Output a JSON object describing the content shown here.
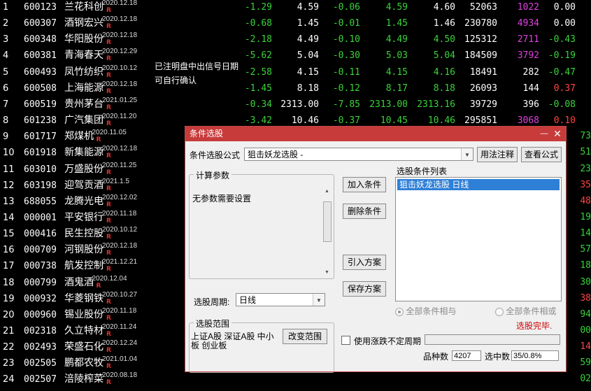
{
  "rows": [
    {
      "idx": "1",
      "code": "600123",
      "name": "兰花科创",
      "date": "2020.12.18",
      "flag": "R",
      "chg": "-1.29",
      "price": "4.59",
      "d": "-0.06",
      "buy": "4.59",
      "sell": "4.60",
      "vol": "52063",
      "cur": "1022",
      "cur_color": "magenta",
      "pct": "0.00",
      "pct_color": "white",
      "sell_color": "white"
    },
    {
      "idx": "2",
      "code": "600307",
      "name": "酒钢宏兴",
      "date": "2020.12.18",
      "flag": "R",
      "chg": "-0.68",
      "price": "1.45",
      "d": "-0.01",
      "buy": "1.45",
      "sell": "1.46",
      "vol": "230780",
      "cur": "4934",
      "cur_color": "magenta",
      "pct": "0.00",
      "pct_color": "white",
      "sell_color": "white"
    },
    {
      "idx": "3",
      "code": "600348",
      "name": "华阳股份",
      "date": "2020.12.18",
      "flag": "R",
      "chg": "-2.18",
      "price": "4.49",
      "d": "-0.10",
      "buy": "4.49",
      "sell": "4.50",
      "vol": "125312",
      "cur": "2711",
      "cur_color": "magenta",
      "pct": "-0.43",
      "pct_color": "green",
      "sell_color": "green"
    },
    {
      "idx": "4",
      "code": "600381",
      "name": "青海春天",
      "date": "2020.12.29",
      "flag": "R",
      "chg": "-5.62",
      "price": "5.04",
      "d": "-0.30",
      "buy": "5.03",
      "sell": "5.04",
      "vol": "184509",
      "cur": "3792",
      "cur_color": "magenta",
      "pct": "-0.19",
      "pct_color": "green",
      "sell_color": "green"
    },
    {
      "idx": "5",
      "code": "600493",
      "name": "凤竹纺织",
      "date": "2020.10.12",
      "flag": "R",
      "chg": "-2.58",
      "price": "4.15",
      "d": "-0.11",
      "buy": "4.15",
      "sell": "4.16",
      "vol": "18491",
      "cur": "282",
      "cur_color": "white",
      "pct": "-0.47",
      "pct_color": "green",
      "sell_color": "green"
    },
    {
      "idx": "6",
      "code": "600508",
      "name": "上海能源",
      "date": "2020.12.18",
      "flag": "R",
      "chg": "-1.45",
      "price": "8.18",
      "d": "-0.12",
      "buy": "8.17",
      "sell": "8.18",
      "vol": "26093",
      "cur": "144",
      "cur_color": "white",
      "pct": "0.37",
      "pct_color": "red",
      "sell_color": "green"
    },
    {
      "idx": "7",
      "code": "600519",
      "name": "贵州茅台",
      "date": "2021.01.25",
      "flag": "R",
      "chg": "-0.34",
      "price": "2313.00",
      "d": "-7.85",
      "buy": "2313.00",
      "sell": "2313.16",
      "vol": "39729",
      "cur": "396",
      "cur_color": "white",
      "pct": "-0.08",
      "pct_color": "green",
      "sell_color": "green"
    },
    {
      "idx": "8",
      "code": "601238",
      "name": "广汽集团",
      "date": "2020.11.20",
      "flag": "R",
      "chg": "-3.42",
      "price": "10.46",
      "d": "-0.37",
      "buy": "10.45",
      "sell": "10.46",
      "vol": "295851",
      "cur": "3068",
      "cur_color": "magenta",
      "pct": "0.10",
      "pct_color": "red",
      "sell_color": "green"
    },
    {
      "idx": "9",
      "code": "601717",
      "name": "郑煤机",
      "date": "2020.11.05",
      "flag": "R"
    },
    {
      "idx": "10",
      "code": "601918",
      "name": "新集能源",
      "date": "2020.12.18",
      "flag": "R"
    },
    {
      "idx": "11",
      "code": "603010",
      "name": "万盛股份",
      "date": "2020.11.25",
      "flag": "R"
    },
    {
      "idx": "12",
      "code": "603198",
      "name": "迎驾贡酒",
      "date": "2021.1.5",
      "flag": "R"
    },
    {
      "idx": "13",
      "code": "688055",
      "name": "龙腾光电",
      "date": "2020.12.02",
      "flag": "R"
    },
    {
      "idx": "14",
      "code": "000001",
      "name": "平安银行",
      "date": "2020.11.18",
      "flag": "R"
    },
    {
      "idx": "15",
      "code": "000416",
      "name": "民生控股",
      "date": "2020.10.12",
      "flag": "R"
    },
    {
      "idx": "16",
      "code": "000709",
      "name": "河钢股份",
      "date": "2020.12.18",
      "flag": "R"
    },
    {
      "idx": "17",
      "code": "000738",
      "name": "航发控制",
      "date": "2021.12.21",
      "flag": "R"
    },
    {
      "idx": "18",
      "code": "000799",
      "name": "酒鬼酒",
      "date": "2020.12.04",
      "flag": "R"
    },
    {
      "idx": "19",
      "code": "000932",
      "name": "华菱钢铁",
      "date": "2020.10.27",
      "flag": "R"
    },
    {
      "idx": "20",
      "code": "000960",
      "name": "锡业股份",
      "date": "2020.11.18",
      "flag": "R"
    },
    {
      "idx": "21",
      "code": "002318",
      "name": "久立特材",
      "date": "2020.11.24",
      "flag": "R"
    },
    {
      "idx": "22",
      "code": "002493",
      "name": "荣盛石化",
      "date": "2020.12.24",
      "flag": "R"
    },
    {
      "idx": "23",
      "code": "002505",
      "name": "鹏都农牧",
      "date": "2021.01.04",
      "flag": "R"
    },
    {
      "idx": "24",
      "code": "002507",
      "name": "涪陵榨菜",
      "date": "2020.08.18",
      "flag": "R"
    }
  ],
  "right_edge": [
    {
      "text": "73",
      "color": "green"
    },
    {
      "text": "51",
      "color": "green"
    },
    {
      "text": "23",
      "color": "green"
    },
    {
      "text": "35",
      "color": "red"
    },
    {
      "text": "48",
      "color": "red"
    },
    {
      "text": "19",
      "color": "green"
    },
    {
      "text": "14",
      "color": "green"
    },
    {
      "text": "57",
      "color": "green"
    },
    {
      "text": "18",
      "color": "green"
    },
    {
      "text": "30",
      "color": "green"
    },
    {
      "text": "38",
      "color": "red"
    },
    {
      "text": "94",
      "color": "green"
    },
    {
      "text": "00",
      "color": "green"
    },
    {
      "text": "14",
      "color": "red"
    },
    {
      "text": "59",
      "color": "green"
    },
    {
      "text": "02",
      "color": "green"
    }
  ],
  "note": {
    "line1": "已注明盘中出信号日期",
    "line2": "可自行确认"
  },
  "dialog": {
    "title": "条件选股",
    "formula_label": "条件选股公式",
    "formula_value": "狙击妖龙选股 -",
    "usage_button": "用法注释",
    "view_button": "查看公式",
    "params_group": "计算参数",
    "params_text": "无参数需要设置",
    "add_button": "加入条件",
    "delete_button": "删除条件",
    "import_button": "引入方案",
    "save_button": "保存方案",
    "list_title": "选股条件列表",
    "list_items": [
      "狙击妖龙选股   日线"
    ],
    "period_label": "选股周期:",
    "period_value": "日线",
    "radio_and": "全部条件相与",
    "radio_or": "全部条件相或",
    "status": "选股完毕.",
    "range_group": "选股范围",
    "range_text": "上证A股 深证A股 中小板 创业板",
    "change_range_button": "改变范围",
    "use_period_label": "使用涨跌不定周期",
    "count_label": "品种数",
    "count_value": "4207",
    "selected_label": "选中数",
    "selected_value": "35/0.8%"
  }
}
